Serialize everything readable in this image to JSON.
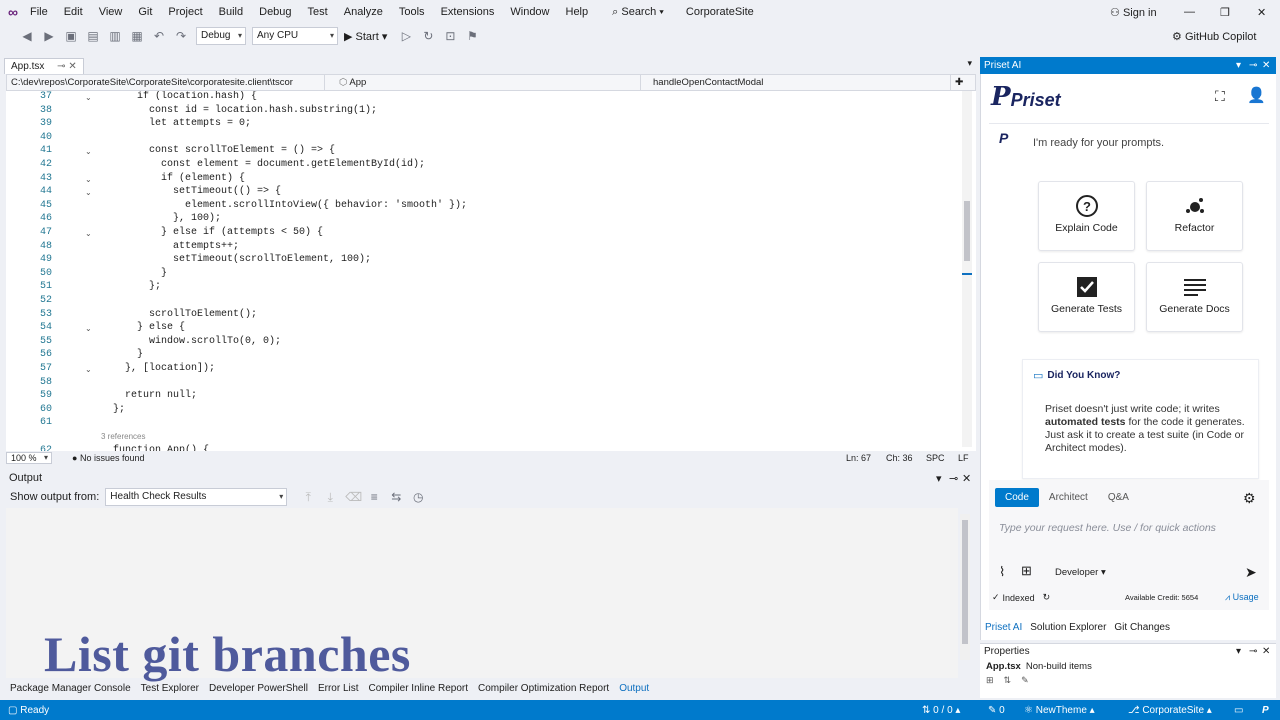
{
  "menu": {
    "items": [
      "File",
      "Edit",
      "View",
      "Git",
      "Project",
      "Build",
      "Debug",
      "Test",
      "Analyze",
      "Tools",
      "Extensions",
      "Window",
      "Help"
    ],
    "search": "Search",
    "solution": "CorporateSite",
    "sign_in": "Sign in"
  },
  "toolbar": {
    "config": "Debug",
    "platform": "Any CPU",
    "start": "Start",
    "copilot": "GitHub Copilot"
  },
  "doc_tab": {
    "name": "App.tsx"
  },
  "nav": {
    "path": "C:\\dev\\repos\\CorporateSite\\CorporateSite\\corporatesite.client\\tscor",
    "scope": "App",
    "member": "handleOpenContactModal"
  },
  "code": {
    "lines": [
      {
        "n": "37",
        "t": "      if (location.hash) {"
      },
      {
        "n": "38",
        "t": "        const id = location.hash.substring(1);"
      },
      {
        "n": "39",
        "t": "        let attempts = 0;"
      },
      {
        "n": "40",
        "t": ""
      },
      {
        "n": "41",
        "t": "        const scrollToElement = () => {"
      },
      {
        "n": "42",
        "t": "          const element = document.getElementById(id);"
      },
      {
        "n": "43",
        "t": "          if (element) {"
      },
      {
        "n": "44",
        "t": "            setTimeout(() => {"
      },
      {
        "n": "45",
        "t": "              element.scrollIntoView({ behavior: 'smooth' });"
      },
      {
        "n": "46",
        "t": "            }, 100);"
      },
      {
        "n": "47",
        "t": "          } else if (attempts < 50) {"
      },
      {
        "n": "48",
        "t": "            attempts++;"
      },
      {
        "n": "49",
        "t": "            setTimeout(scrollToElement, 100);"
      },
      {
        "n": "50",
        "t": "          }"
      },
      {
        "n": "51",
        "t": "        };"
      },
      {
        "n": "52",
        "t": ""
      },
      {
        "n": "53",
        "t": "        scrollToElement();"
      },
      {
        "n": "54",
        "t": "      } else {"
      },
      {
        "n": "55",
        "t": "        window.scrollTo(0, 0);"
      },
      {
        "n": "56",
        "t": "      }"
      },
      {
        "n": "57",
        "t": "    }, [location]);"
      },
      {
        "n": "58",
        "t": ""
      },
      {
        "n": "59",
        "t": "    return null;"
      },
      {
        "n": "60",
        "t": "  };"
      },
      {
        "n": "61",
        "t": ""
      },
      {
        "n": "62",
        "t": "  function App() {"
      }
    ],
    "references": "3 references"
  },
  "editor_status": {
    "zoom": "100 %",
    "issues": "No issues found",
    "ln": "Ln: 67",
    "ch": "Ch: 36",
    "ws": "SPC",
    "eol": "LF"
  },
  "output": {
    "title": "Output",
    "show_from_label": "Show output from:",
    "source": "Health Check Results"
  },
  "bottom_tabs": [
    "Package Manager Console",
    "Test Explorer",
    "Developer PowerShell",
    "Error List",
    "Compiler Inline Report",
    "Compiler Optimization Report",
    "Output"
  ],
  "caption": "List git branches",
  "status": {
    "ready": "Ready",
    "git_counts": "0 / 0",
    "edits": "0",
    "theme": "NewTheme",
    "branch": "CorporateSite"
  },
  "panel": {
    "title": "Priset AI",
    "logo_text": "Priset",
    "ready_msg": "I'm ready for your prompts.",
    "cards": [
      {
        "label": "Explain Code",
        "icon": "question-icon"
      },
      {
        "label": "Refactor",
        "icon": "refactor-icon"
      },
      {
        "label": "Generate Tests",
        "icon": "checkbox-icon"
      },
      {
        "label": "Generate Docs",
        "icon": "docs-icon"
      }
    ],
    "did_you_know_title": "Did You Know?",
    "tip_pre": "Priset doesn't just write code; it writes ",
    "tip_bold": "automated tests",
    "tip_post": " for the code it generates. Just ask it to create a test suite (in Code or Architect modes).",
    "modes": [
      "Code",
      "Architect",
      "Q&A"
    ],
    "input_placeholder": "Type your request here. Use / for quick actions",
    "role": "Developer",
    "indexed": "Indexed",
    "credit": "Available Credit: 5654",
    "usage": "Usage",
    "tabs": [
      "Priset AI",
      "Solution Explorer",
      "Git Changes"
    ],
    "accent": "#007acc"
  },
  "properties": {
    "title": "Properties",
    "file": "App.tsx",
    "kind": "Non-build items"
  }
}
